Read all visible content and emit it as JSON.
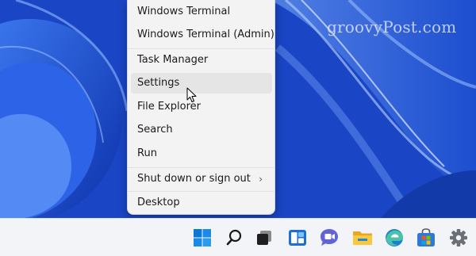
{
  "watermark": "groovyPost.com",
  "menu": {
    "items": [
      {
        "label": "Windows Terminal"
      },
      {
        "label": "Windows Terminal (Admin)"
      },
      {
        "label": "Task Manager"
      },
      {
        "label": "Settings",
        "state": "hover"
      },
      {
        "label": "File Explorer"
      },
      {
        "label": "Search"
      },
      {
        "label": "Run"
      },
      {
        "label": "Shut down or sign out",
        "has_submenu": true,
        "submenu_glyph": "›"
      },
      {
        "label": "Desktop"
      }
    ]
  },
  "taskbar": {
    "icons": [
      "windows-start-icon",
      "search-icon",
      "task-view-icon",
      "widgets-icon",
      "teams-chat-icon",
      "file-explorer-icon",
      "edge-browser-icon",
      "microsoft-store-icon",
      "settings-gear-icon"
    ]
  },
  "colors": {
    "wallpaper": "#1b47c9",
    "menu_bg": "#f3f3f3",
    "hover_bg": "#e5e5e5",
    "taskbar_bg": "#f2f4f8",
    "windows_blue": "#0a78d4"
  }
}
